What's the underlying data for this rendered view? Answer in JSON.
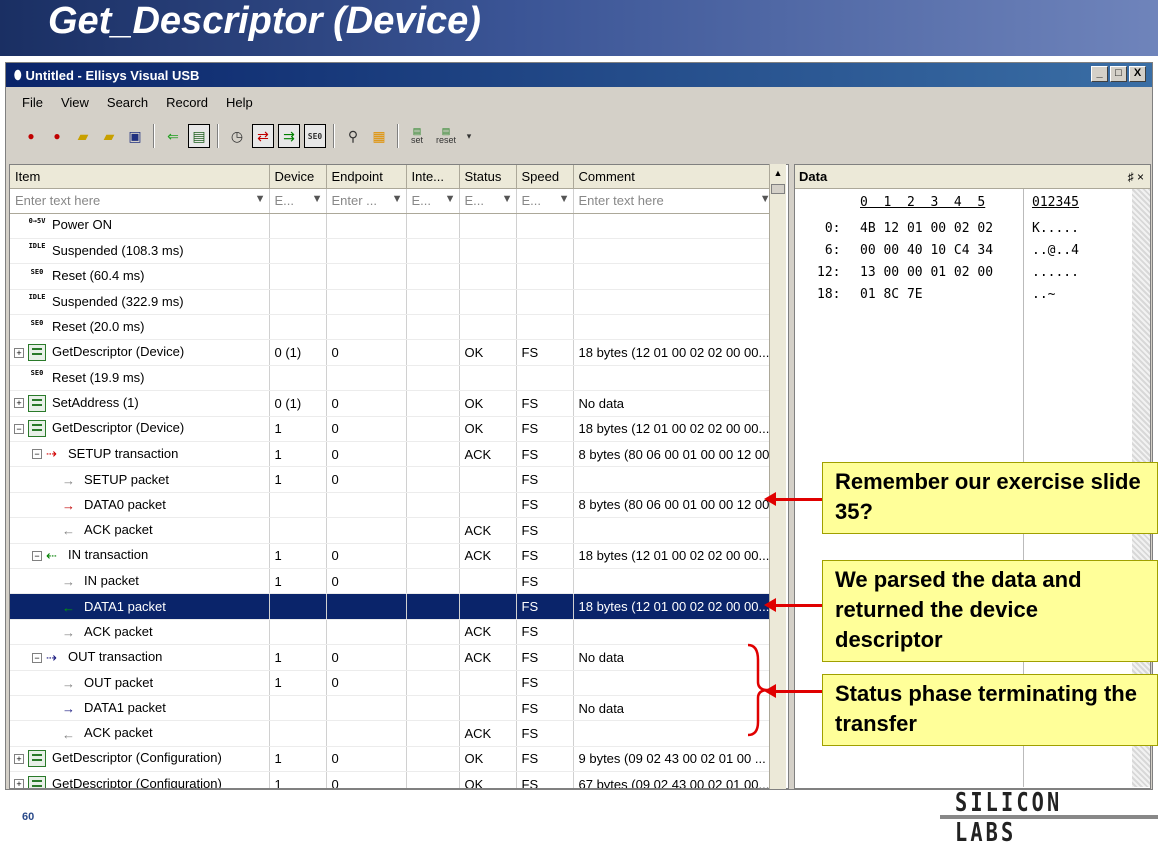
{
  "slide": {
    "title": "Get_Descriptor (Device)",
    "page_number": "60",
    "logo": "SILICON LABS"
  },
  "window": {
    "title": "Untitled - Ellisys Visual USB",
    "buttons": [
      "_",
      "□",
      "X"
    ]
  },
  "menu": [
    "File",
    "View",
    "Search",
    "Record",
    "Help"
  ],
  "toolbar": {
    "icons": [
      "record-icon",
      "record-options-icon",
      "open-icon",
      "open-add-icon",
      "save-icon",
      "back-icon",
      "view-icon",
      "timer-icon",
      "transfer-icon",
      "transaction-icon",
      "setup-icon",
      "find-icon",
      "color-icon",
      "set-icon",
      "reset-icon"
    ],
    "set_label": "set",
    "reset_label": "reset"
  },
  "grid": {
    "columns": [
      "Item",
      "Device",
      "Endpoint",
      "Inte...",
      "Status",
      "Speed",
      "Comment"
    ],
    "filters": [
      "Enter text here",
      "E...",
      "Enter ...",
      "E...",
      "E...",
      "E...",
      "Enter text here"
    ],
    "rows": [
      {
        "level": 0,
        "type": "power",
        "icon_text": "0→5V",
        "item": "Power ON",
        "device": "",
        "endpoint": "",
        "inte": "",
        "status": "",
        "speed": "",
        "comment": ""
      },
      {
        "level": 0,
        "type": "idle",
        "icon_text": "IDLE",
        "item": "Suspended (108.3 ms)",
        "device": "",
        "endpoint": "",
        "inte": "",
        "status": "",
        "speed": "",
        "comment": ""
      },
      {
        "level": 0,
        "type": "se0",
        "icon_text": "SE0",
        "item": "Reset (60.4 ms)",
        "device": "",
        "endpoint": "",
        "inte": "",
        "status": "",
        "speed": "",
        "comment": ""
      },
      {
        "level": 0,
        "type": "idle",
        "icon_text": "IDLE",
        "item": "Suspended (322.9 ms)",
        "device": "",
        "endpoint": "",
        "inte": "",
        "status": "",
        "speed": "",
        "comment": ""
      },
      {
        "level": 0,
        "type": "se0",
        "icon_text": "SE0",
        "item": "Reset (20.0 ms)",
        "device": "",
        "endpoint": "",
        "inte": "",
        "status": "",
        "speed": "",
        "comment": ""
      },
      {
        "level": 0,
        "type": "device",
        "expand": "+",
        "item": "GetDescriptor (Device)",
        "device": "0 (1)",
        "endpoint": "0",
        "inte": "",
        "status": "OK",
        "speed": "FS",
        "comment": "18 bytes (12 01 00 02 02 00 00..."
      },
      {
        "level": 0,
        "type": "se0",
        "icon_text": "SE0",
        "item": "Reset (19.9 ms)",
        "device": "",
        "endpoint": "",
        "inte": "",
        "status": "",
        "speed": "",
        "comment": ""
      },
      {
        "level": 0,
        "type": "device",
        "expand": "+",
        "item": "SetAddress (1)",
        "device": "0 (1)",
        "endpoint": "0",
        "inte": "",
        "status": "OK",
        "speed": "FS",
        "comment": "No data"
      },
      {
        "level": 0,
        "type": "device",
        "expand": "-",
        "item": "GetDescriptor (Device)",
        "device": "1",
        "endpoint": "0",
        "inte": "",
        "status": "OK",
        "speed": "FS",
        "comment": "18 bytes (12 01 00 02 02 00 00..."
      },
      {
        "level": 1,
        "type": "txn",
        "expand": "-",
        "arrow": "⇢",
        "arrow_color": "#d00000",
        "item": "SETUP transaction",
        "device": "1",
        "endpoint": "0",
        "inte": "",
        "status": "ACK",
        "speed": "FS",
        "comment": "8 bytes (80 06 00 01 00 00 12 00)"
      },
      {
        "level": 2,
        "type": "pkt",
        "arrow": "→",
        "arrow_color": "#808080",
        "item": "SETUP packet",
        "device": "1",
        "endpoint": "0",
        "inte": "",
        "status": "",
        "speed": "FS",
        "comment": ""
      },
      {
        "level": 2,
        "type": "pkt",
        "arrow": "→",
        "arrow_color": "#c00000",
        "item": "DATA0 packet",
        "device": "",
        "endpoint": "",
        "inte": "",
        "status": "",
        "speed": "FS",
        "comment": "8 bytes (80 06 00 01 00 00 12 00)"
      },
      {
        "level": 2,
        "type": "pkt",
        "arrow": "←",
        "arrow_color": "#808080",
        "item": "ACK packet",
        "device": "",
        "endpoint": "",
        "inte": "",
        "status": "ACK",
        "speed": "FS",
        "comment": ""
      },
      {
        "level": 1,
        "type": "txn",
        "expand": "-",
        "arrow": "⇠",
        "arrow_color": "#008000",
        "item": "IN transaction",
        "device": "1",
        "endpoint": "0",
        "inte": "",
        "status": "ACK",
        "speed": "FS",
        "comment": "18 bytes (12 01 00 02 02 00 00..."
      },
      {
        "level": 2,
        "type": "pkt",
        "arrow": "→",
        "arrow_color": "#808080",
        "item": "IN packet",
        "device": "1",
        "endpoint": "0",
        "inte": "",
        "status": "",
        "speed": "FS",
        "comment": ""
      },
      {
        "level": 2,
        "type": "pkt",
        "arrow": "←",
        "arrow_color": "#00a000",
        "item": "DATA1 packet",
        "device": "",
        "endpoint": "",
        "inte": "",
        "status": "",
        "speed": "FS",
        "comment": "18 bytes (12 01 00 02 02 00 00...",
        "selected": true
      },
      {
        "level": 2,
        "type": "pkt",
        "arrow": "→",
        "arrow_color": "#808080",
        "item": "ACK packet",
        "device": "",
        "endpoint": "",
        "inte": "",
        "status": "ACK",
        "speed": "FS",
        "comment": ""
      },
      {
        "level": 1,
        "type": "txn",
        "expand": "-",
        "arrow": "⇢",
        "arrow_color": "#1a1a80",
        "item": "OUT transaction",
        "device": "1",
        "endpoint": "0",
        "inte": "",
        "status": "ACK",
        "speed": "FS",
        "comment": "No data"
      },
      {
        "level": 2,
        "type": "pkt",
        "arrow": "→",
        "arrow_color": "#808080",
        "item": "OUT packet",
        "device": "1",
        "endpoint": "0",
        "inte": "",
        "status": "",
        "speed": "FS",
        "comment": ""
      },
      {
        "level": 2,
        "type": "pkt",
        "arrow": "→",
        "arrow_color": "#1a1a80",
        "item": "DATA1 packet",
        "device": "",
        "endpoint": "",
        "inte": "",
        "status": "",
        "speed": "FS",
        "comment": "No data"
      },
      {
        "level": 2,
        "type": "pkt",
        "arrow": "←",
        "arrow_color": "#808080",
        "item": "ACK packet",
        "device": "",
        "endpoint": "",
        "inte": "",
        "status": "ACK",
        "speed": "FS",
        "comment": ""
      },
      {
        "level": 0,
        "type": "device",
        "expand": "+",
        "item": "GetDescriptor (Configuration)",
        "device": "1",
        "endpoint": "0",
        "inte": "",
        "status": "OK",
        "speed": "FS",
        "comment": "9 bytes (09 02 43 00 02 01 00 ..."
      },
      {
        "level": 0,
        "type": "device",
        "expand": "+",
        "item": "GetDescriptor (Configuration)",
        "device": "1",
        "endpoint": "0",
        "inte": "",
        "status": "OK",
        "speed": "FS",
        "comment": "67 bytes (09 02 43 00 02 01 00..."
      }
    ]
  },
  "data_panel": {
    "title": "Data",
    "pin": "♯ ×",
    "header_offsets": "0  1  2  3  4  5",
    "header_ascii": "012345",
    "rows": [
      {
        "offset": " 0:",
        "hex": "4B 12 01 00 02 02",
        "ascii": "K....."
      },
      {
        "offset": " 6:",
        "hex": "00 00 40 10 C4 34",
        "ascii": "..@..4"
      },
      {
        "offset": "12:",
        "hex": "13 00 00 01 02 00",
        "ascii": "......"
      },
      {
        "offset": "18:",
        "hex": "01 8C 7E",
        "ascii": "..~"
      }
    ]
  },
  "callouts": [
    {
      "text": "Remember our exercise slide 35?"
    },
    {
      "text": "We parsed the data and returned the device descriptor"
    },
    {
      "text": "Status phase terminating the transfer"
    }
  ]
}
